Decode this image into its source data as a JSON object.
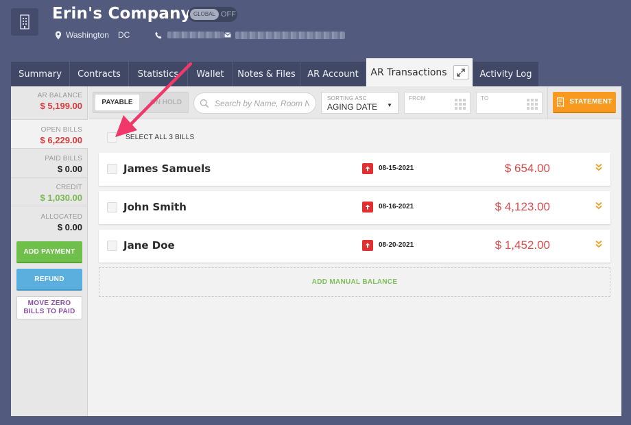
{
  "header": {
    "company_name": "Erin's Company",
    "global_toggle": {
      "label": "GLOBAL",
      "state": "OFF"
    },
    "city": "Washington",
    "state": "DC"
  },
  "tabs": [
    {
      "label": "Summary",
      "active": false
    },
    {
      "label": "Contracts",
      "active": false
    },
    {
      "label": "Statistics",
      "active": false
    },
    {
      "label": "Wallet",
      "active": false
    },
    {
      "label": "Notes & Files",
      "active": false
    },
    {
      "label": "AR Account",
      "active": false
    },
    {
      "label": "AR Transactions",
      "active": true
    },
    {
      "label": "Activity Log",
      "active": false
    }
  ],
  "sidebar": {
    "ar_balance": {
      "label": "AR BALANCE",
      "value": "$ 5,199.00",
      "color": "#d63c3c"
    },
    "open_bills": {
      "label": "OPEN BILLS",
      "value": "$ 6,229.00",
      "color": "#d63c3c"
    },
    "paid_bills": {
      "label": "PAID BILLS",
      "value": "$ 0.00",
      "color": "#222222"
    },
    "credit": {
      "label": "CREDIT",
      "value": "$ 1,030.00",
      "color": "#78b84e"
    },
    "allocated": {
      "label": "ALLOCATED",
      "value": "$ 0.00",
      "color": "#222222"
    },
    "add_payment": "ADD PAYMENT",
    "refund": "REFUND",
    "move_zero": "MOVE ZERO BILLS TO PAID"
  },
  "toolbar": {
    "payable": "PAYABLE",
    "on_hold": "ON HOLD",
    "search_placeholder": "Search by Name, Room Nc",
    "sorting_label": "SORTING ASC",
    "sorting_value": "AGING DATE",
    "from_label": "FROM",
    "to_label": "TO",
    "statement": "STATEMENT"
  },
  "content": {
    "select_all": "SELECT ALL 3 BILLS",
    "bills": [
      {
        "name": "James Samuels",
        "date": "08-15-2021",
        "amount": "$ 654.00"
      },
      {
        "name": "John Smith",
        "date": "08-16-2021",
        "amount": "$ 4,123.00"
      },
      {
        "name": "Jane Doe",
        "date": "08-20-2021",
        "amount": "$ 1,452.00"
      }
    ],
    "add_manual_balance": "ADD MANUAL BALANCE"
  },
  "icons": {
    "company": "building-icon",
    "location": "map-pin-icon",
    "phone": "phone-icon",
    "email": "mail-icon",
    "search": "search-icon",
    "calendar": "calendar-icon",
    "statement": "receipt-icon",
    "overdue": "arrow-up-icon",
    "expand": "chevron-double-down-icon",
    "popout": "expand-icon"
  },
  "colors": {
    "background": "#525b7d",
    "tab": "#414866",
    "amount_red": "#d94c4c",
    "accent_orange": "#f79a1f",
    "green": "#6fc04a",
    "blue": "#5aafde",
    "annotation_arrow": "#f0386b"
  }
}
